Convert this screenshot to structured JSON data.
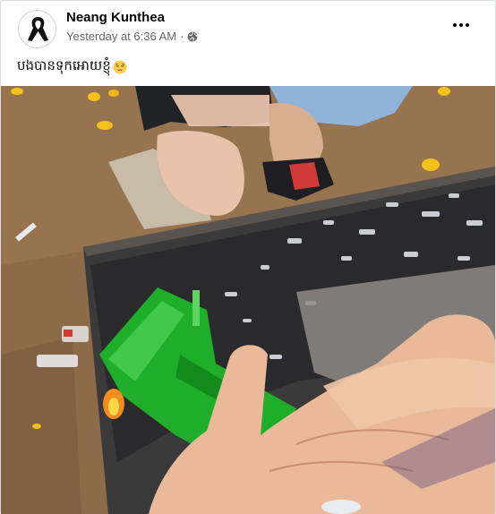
{
  "post": {
    "author_name": "Neang Kunthea",
    "timestamp": "Yesterday at 6:36 AM",
    "separator": "·",
    "audience_icon": "globe-icon",
    "more_icon": "more-options-icon",
    "caption_text": "បងបានទុកអោយខ្ញុំ",
    "caption_emoji": "pensive-face-emoji",
    "avatar_icon": "black-mourning-ribbon-icon"
  },
  "colors": {
    "name": "#050505",
    "meta": "#65676b",
    "leaf_green": "#1fae2a",
    "soil": "#8b6a48"
  }
}
